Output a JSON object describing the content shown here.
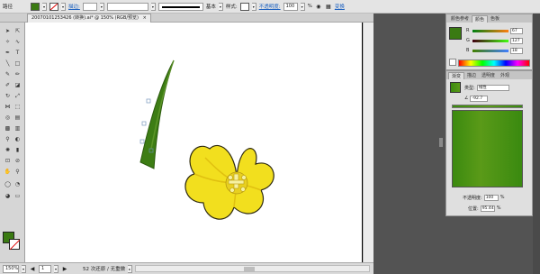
{
  "control_bar": {
    "label_left": "路径",
    "fill_color": "#3a7a12",
    "stroke_label": "描边:",
    "stroke_weight": "",
    "stroke_style_label": "基本",
    "style_label": "样式:",
    "opacity_label": "不透明度:",
    "opacity_value": "100",
    "opacity_unit": "%",
    "transform_label": "变换"
  },
  "tab": {
    "title": "20070101253426 (转换).ai* @ 150% (RGB/预览)"
  },
  "status": {
    "zoom": "150%",
    "page": "1",
    "info": "52 次还原 / 无重做"
  },
  "color_panel": {
    "tabs": [
      "颜色参考",
      "颜色",
      "色板"
    ],
    "active_tab": 1,
    "swatch_color": "#3a7a12",
    "sliders": [
      {
        "label": "R",
        "value": "67"
      },
      {
        "label": "G",
        "value": "127"
      },
      {
        "label": "B",
        "value": "18"
      }
    ]
  },
  "gradient_panel": {
    "tabs": [
      "渐变",
      "描边",
      "透明度",
      "外观"
    ],
    "type_label": "类型:",
    "type_value": "线性",
    "angle_value": "-92.7",
    "opacity_label": "不透明度:",
    "opacity_value": "100",
    "position_label": "位置:",
    "position_value": "95.44",
    "percent": "%"
  }
}
